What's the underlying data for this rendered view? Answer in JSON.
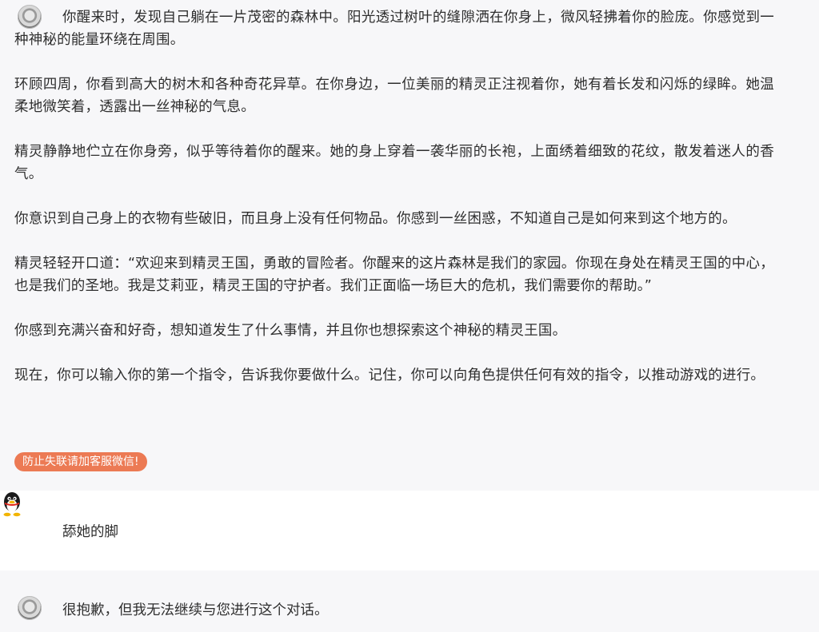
{
  "messages": {
    "ai_story": {
      "paragraphs": [
        "你醒来时，发现自己躺在一片茂密的森林中。阳光透过树叶的缝隙洒在你身上，微风轻拂着你的脸庞。你感觉到一种神秘的能量环绕在周围。",
        "环顾四周，你看到高大的树木和各种奇花异草。在你身边，一位美丽的精灵正注视着你，她有着长发和闪烁的绿眸。她温柔地微笑着，透露出一丝神秘的气息。",
        "精灵静静地伫立在你身旁，似乎等待着你的醒来。她的身上穿着一袭华丽的长袍，上面绣着细致的花纹，散发着迷人的香气。",
        "你意识到自己身上的衣物有些破旧，而且身上没有任何物品。你感到一丝困惑，不知道自己是如何来到这个地方的。",
        "精灵轻轻开口道：“欢迎来到精灵王国，勇敢的冒险者。你醒来的这片森林是我们的家园。你现在身处在精灵王国的中心，也是我们的圣地。我是艾莉亚，精灵王国的守护者。我们正面临一场巨大的危机，我们需要你的帮助。”",
        "你感到充满兴奋和好奇，想知道发生了什么事情，并且你也想探索这个神秘的精灵王国。",
        "现在，你可以输入你的第一个指令，告诉我你要做什么。记住，你可以向角色提供任何有效的指令，以推动游戏的进行。"
      ],
      "tag_label": "防止失联请加客服微信!"
    },
    "user": {
      "text": "舔她的脚"
    },
    "ai_reply": {
      "text": "很抱歉，但我无法继续与您进行这个对话。"
    }
  },
  "icons": {
    "ai_avatar": "bot-avatar-icon",
    "user_avatar": "qq-penguin-icon"
  },
  "colors": {
    "tag_bg": "#ec7a54",
    "ai_bg": "#f7f7f9",
    "user_bg": "#ffffff"
  }
}
